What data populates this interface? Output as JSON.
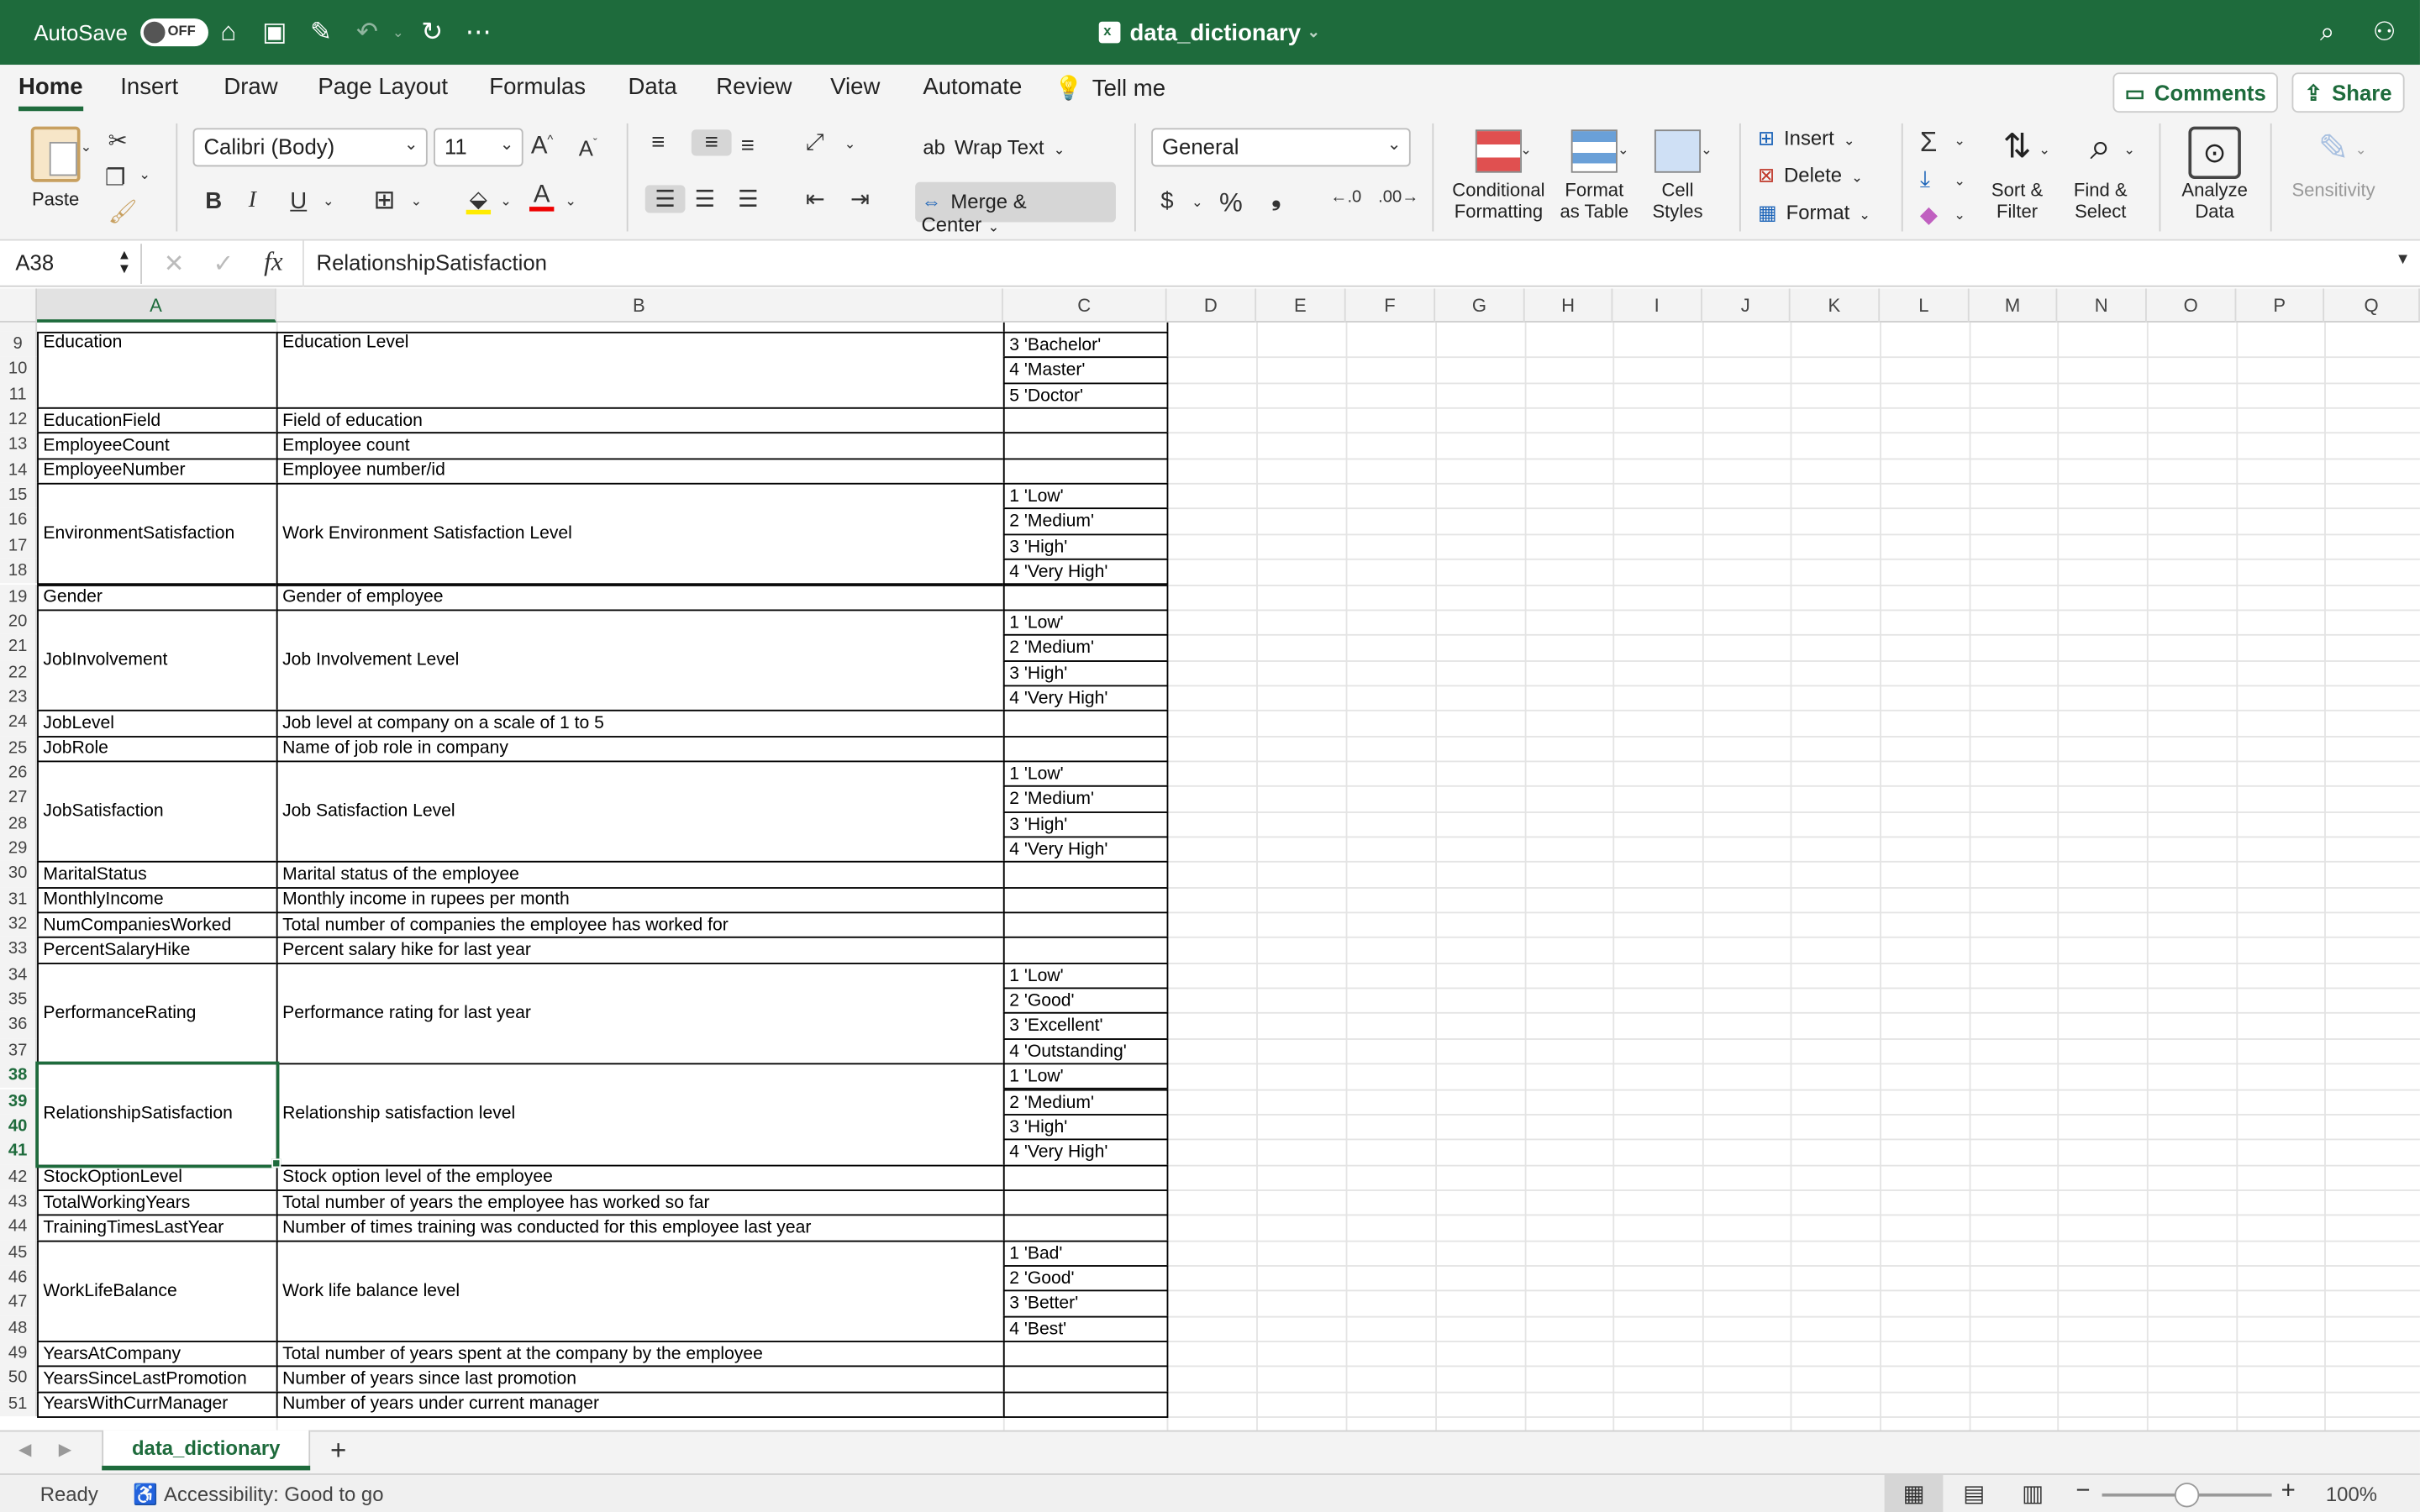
{
  "titlebar": {
    "autosave_label": "AutoSave",
    "autosave_state": "OFF",
    "doc_title": "data_dictionary",
    "bg_color": "#1e6b3c"
  },
  "tabs": [
    "Home",
    "Insert",
    "Draw",
    "Page Layout",
    "Formulas",
    "Data",
    "Review",
    "View",
    "Automate"
  ],
  "tell_me": "Tell me",
  "comments_label": "Comments",
  "share_label": "Share",
  "ribbon": {
    "paste": "Paste",
    "font_name": "Calibri (Body)",
    "font_size": "11",
    "wrap_text": "Wrap Text",
    "merge_center": "Merge & Center",
    "number_format": "General",
    "conditional_formatting": [
      "Conditional",
      "Formatting"
    ],
    "format_as_table": [
      "Format",
      "as Table"
    ],
    "cell_styles": [
      "Cell",
      "Styles"
    ],
    "insert": "Insert",
    "delete": "Delete",
    "format": "Format",
    "sort_filter": [
      "Sort &",
      "Filter"
    ],
    "find_select": [
      "Find &",
      "Select"
    ],
    "analyze_data": [
      "Analyze",
      "Data"
    ],
    "sensitivity": "Sensitivity"
  },
  "formula_bar": {
    "name_box": "A38",
    "fx": "fx",
    "content": "RelationshipSatisfaction"
  },
  "columns": [
    "A",
    "B",
    "C",
    "D",
    "E",
    "F",
    "G",
    "H",
    "I",
    "J",
    "K",
    "L",
    "M",
    "N",
    "O",
    "P",
    "Q"
  ],
  "row_numbers": [
    "9",
    "10",
    "11",
    "12",
    "13",
    "14",
    "15",
    "16",
    "17",
    "18",
    "19",
    "20",
    "21",
    "22",
    "23",
    "24",
    "25",
    "26",
    "27",
    "28",
    "29",
    "30",
    "31",
    "32",
    "33",
    "34",
    "35",
    "36",
    "37",
    "38",
    "39",
    "40",
    "41",
    "42",
    "43",
    "44",
    "45",
    "46",
    "47",
    "48",
    "49",
    "50",
    "51"
  ],
  "entries": [
    {
      "row": 9,
      "span": 3,
      "name": "Education",
      "desc": "Education Level",
      "codes": [
        "3 'Bachelor'",
        "4 'Master'",
        "5 'Doctor'"
      ]
    },
    {
      "row": 12,
      "span": 1,
      "name": "EducationField",
      "desc": "Field of education",
      "codes": [
        ""
      ]
    },
    {
      "row": 13,
      "span": 1,
      "name": "EmployeeCount",
      "desc": "Employee count",
      "codes": [
        ""
      ]
    },
    {
      "row": 14,
      "span": 1,
      "name": "EmployeeNumber",
      "desc": "Employee number/id",
      "codes": [
        ""
      ]
    },
    {
      "row": 15,
      "span": 4,
      "name": "EnvironmentSatisfaction",
      "desc": "Work Environment Satisfaction Level",
      "codes": [
        "1 'Low'",
        "2 'Medium'",
        "3 'High'",
        "4 'Very High'"
      ]
    },
    {
      "row": 19,
      "span": 1,
      "name": "Gender",
      "desc": "Gender of employee",
      "codes": [
        ""
      ]
    },
    {
      "row": 20,
      "span": 4,
      "name": "JobInvolvement",
      "desc": "Job Involvement Level",
      "codes": [
        "1 'Low'",
        "2 'Medium'",
        "3 'High'",
        "4 'Very High'"
      ]
    },
    {
      "row": 24,
      "span": 1,
      "name": "JobLevel",
      "desc": "Job level at company on a scale of 1 to 5",
      "codes": [
        ""
      ]
    },
    {
      "row": 25,
      "span": 1,
      "name": "JobRole",
      "desc": "Name of job role in company",
      "codes": [
        ""
      ]
    },
    {
      "row": 26,
      "span": 4,
      "name": "JobSatisfaction",
      "desc": "Job Satisfaction Level",
      "codes": [
        "1 'Low'",
        "2 'Medium'",
        "3 'High'",
        "4 'Very High'"
      ]
    },
    {
      "row": 30,
      "span": 1,
      "name": "MaritalStatus",
      "desc": "Marital status of the employee",
      "codes": [
        ""
      ]
    },
    {
      "row": 31,
      "span": 1,
      "name": "MonthlyIncome",
      "desc": "Monthly income in rupees per month",
      "codes": [
        ""
      ]
    },
    {
      "row": 32,
      "span": 1,
      "name": "NumCompaniesWorked",
      "desc": "Total number of companies the employee has worked for",
      "codes": [
        ""
      ]
    },
    {
      "row": 33,
      "span": 1,
      "name": "PercentSalaryHike",
      "desc": "Percent salary hike for last year",
      "codes": [
        ""
      ]
    },
    {
      "row": 34,
      "span": 4,
      "name": "PerformanceRating",
      "desc": "Performance rating for last year",
      "codes": [
        "1 'Low'",
        "2 'Good'",
        "3 'Excellent'",
        "4 'Outstanding'"
      ]
    },
    {
      "row": 38,
      "span": 4,
      "name": "RelationshipSatisfaction",
      "desc": "Relationship satisfaction level",
      "codes": [
        "1 'Low'",
        "2 'Medium'",
        "3 'High'",
        "4 'Very High'"
      ]
    },
    {
      "row": 42,
      "span": 1,
      "name": "StockOptionLevel",
      "desc": "Stock option level of the employee",
      "codes": [
        ""
      ]
    },
    {
      "row": 43,
      "span": 1,
      "name": "TotalWorkingYears",
      "desc": "Total number of years the employee has worked so far",
      "codes": [
        ""
      ]
    },
    {
      "row": 44,
      "span": 1,
      "name": "TrainingTimesLastYear",
      "desc": "Number of times training was conducted for this employee last year",
      "codes": [
        ""
      ]
    },
    {
      "row": 45,
      "span": 4,
      "name": "WorkLifeBalance",
      "desc": "Work life balance level",
      "codes": [
        "1 'Bad'",
        "2 'Good'",
        "3 'Better'",
        "4 'Best'"
      ]
    },
    {
      "row": 49,
      "span": 1,
      "name": "YearsAtCompany",
      "desc": "Total number of years spent at the company by the employee",
      "codes": [
        ""
      ]
    },
    {
      "row": 50,
      "span": 1,
      "name": "YearsSinceLastPromotion",
      "desc": "Number of years since last promotion",
      "codes": [
        ""
      ]
    },
    {
      "row": 51,
      "span": 1,
      "name": "YearsWithCurrManager",
      "desc": "Number of years under current manager",
      "codes": [
        ""
      ]
    }
  ],
  "selected_cell": "A38",
  "sheet_tab": "data_dictionary",
  "status": {
    "ready": "Ready",
    "accessibility": "Accessibility: Good to go",
    "zoom": "100%"
  }
}
